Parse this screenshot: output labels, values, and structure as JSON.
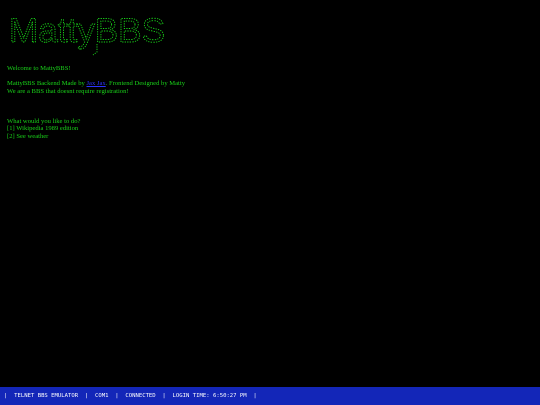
{
  "logo": {
    "text": "MattyBBS",
    "color": "#19d419"
  },
  "screen": {
    "welcome": "Welcome to MattyBBS!",
    "credits_prefix": "MattyBBS Backend Made by ",
    "credits_link": "Jax Jax",
    "credits_suffix": ". Frontend Designed by Matty",
    "notice": "We are a BBS that doesnt require registration!",
    "prompt": "What would you like to do?",
    "options": [
      "[1] Wikipedia 1989 edition",
      "[2] See weather"
    ]
  },
  "status_bar": {
    "separator": "|",
    "emulator": "TELNET BBS EMULATOR",
    "port": "COM1",
    "state": "CONNECTED",
    "login_label": "LOGIN TIME:",
    "login_time": "6:50:27 PM",
    "background": "#1326b8"
  },
  "colors": {
    "terminal_text": "#19d419",
    "link": "#2b34ff",
    "background": "#000000"
  }
}
